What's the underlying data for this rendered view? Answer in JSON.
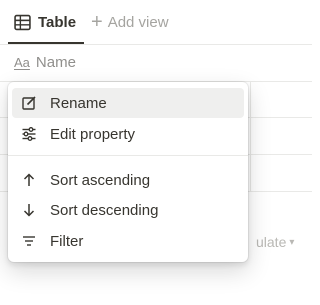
{
  "tabs": {
    "items": [
      {
        "label": "Table",
        "icon": "table-icon",
        "active": true
      },
      {
        "label": "Add view",
        "icon": "plus-icon",
        "active": false
      }
    ]
  },
  "table": {
    "header": {
      "name_label": "Name",
      "name_icon": "text-property-icon"
    },
    "calculate_label": "ulate"
  },
  "context_menu": {
    "items": [
      {
        "label": "Rename",
        "icon": "rename-icon",
        "highlighted": true
      },
      {
        "label": "Edit property",
        "icon": "sliders-icon",
        "highlighted": false
      },
      {
        "label": "Sort ascending",
        "icon": "arrow-up-icon",
        "highlighted": false
      },
      {
        "label": "Sort descending",
        "icon": "arrow-down-icon",
        "highlighted": false
      },
      {
        "label": "Filter",
        "icon": "filter-icon",
        "highlighted": false
      }
    ]
  },
  "colors": {
    "text": "#37352f",
    "muted": "#a5a4a0",
    "border": "#e9e9e7",
    "hover": "#efefee"
  }
}
